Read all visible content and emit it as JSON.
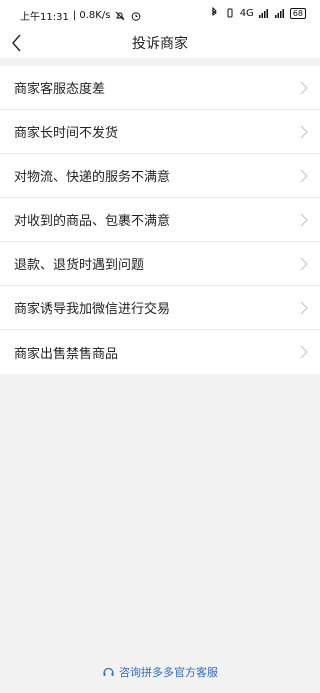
{
  "status_bar": {
    "time": "上午11:31",
    "speed": "| 0.8K/s",
    "network": "4G",
    "battery": "68"
  },
  "header": {
    "title": "投诉商家"
  },
  "menu": {
    "items": [
      {
        "label": "商家客服态度差"
      },
      {
        "label": "商家长时间不发货"
      },
      {
        "label": "对物流、快递的服务不满意"
      },
      {
        "label": "对收到的商品、包裹不满意"
      },
      {
        "label": "退款、退货时遇到问题"
      },
      {
        "label": "商家诱导我加微信进行交易"
      },
      {
        "label": "商家出售禁售商品"
      }
    ]
  },
  "footer": {
    "link_label": "咨询拼多多官方客服"
  },
  "colors": {
    "accent": "#2f6db6",
    "background": "#f2f2f2"
  }
}
